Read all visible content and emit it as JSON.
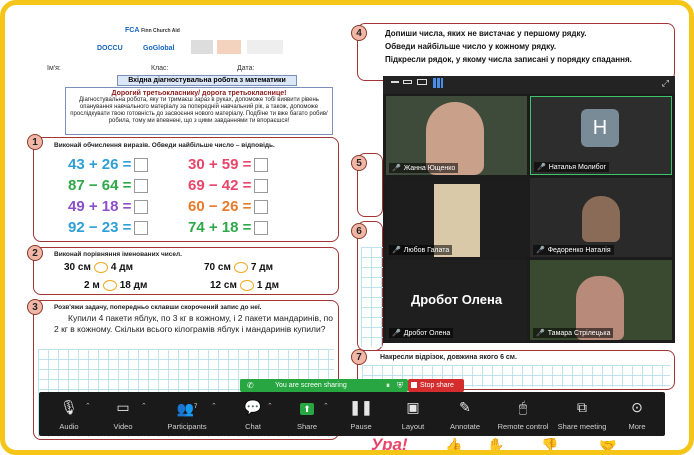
{
  "worksheet": {
    "logos": [
      "FCA",
      "Finn Church Aid",
      "DOCCU",
      "GoGlobal"
    ],
    "name_label": "Ім'я:",
    "class_label": "Клас:",
    "date_label": "Дата:",
    "title": "Вхідна діагностувальна робота з математики",
    "intro_heading": "Дорогий третьокласнику/ дорога третьокласнице!",
    "intro_text": "Діагностувальна робота, яку ти тримаєш зараз в руках, допоможе тобі виявити рівень опанування навчального матеріалу за попередній навчальний рік, а також, допоможе прослідкувати твою готовність до засвоєння нового матеріалу. Подбіне ти вже багато робив/робила, тому ми впевнені, що з цими завданнями ти впораєшся!",
    "task1": {
      "num": "1",
      "title": "Виконай обчислення виразів. Обведи найбільше число – відповідь.",
      "rows": [
        "43 + 26 =",
        "30 + 59 =",
        "87 − 64 =",
        "69 − 42 =",
        "49 + 18 =",
        "60 − 26 =",
        "92 − 23 =",
        "74 + 18 ="
      ]
    },
    "task2": {
      "num": "2",
      "title": "Виконай порівняння іменованих чисел.",
      "rows": [
        [
          "30 см",
          "4 дм"
        ],
        [
          "70 см",
          "7 дм"
        ],
        [
          "2 м",
          "18 дм"
        ],
        [
          "12 см",
          "1 дм"
        ]
      ]
    },
    "task3": {
      "num": "3",
      "title": "Розв'яжи задачу, попередньо склавши скорочений запис до неї.",
      "problem": "Купили 4 пакети яблук, по 3 кг в кожному, і 2 пакети мандаринів, по 2 кг в кожному. Скільки всього кілограмів яблук і мандаринів купили?"
    },
    "task4": {
      "num": "4",
      "lines": [
        "Допиши числа, яких не вистачає у першому рядку.",
        "Обведи найбільше число у кожному рядку.",
        "Підкресли рядок, у якому числа записані у порядку спадання."
      ]
    },
    "task5_num": "5",
    "task6_num": "6",
    "task7": {
      "num": "7",
      "title": "Накресли відрізок, довжина якого 6 см."
    },
    "bottom_text": "Ура!"
  },
  "meeting": {
    "participants": [
      {
        "name": "Жанна Ющенко"
      },
      {
        "name": "Наталья Молибог",
        "initial": "H"
      },
      {
        "name": "Любов Галата"
      },
      {
        "name": "Федоренко Наталія"
      },
      {
        "name": "Дробот Олена",
        "display": "Дробот Олена"
      },
      {
        "name": "Тамара Стрілецька"
      }
    ]
  },
  "share_banner": {
    "text": "You are screen sharing",
    "stop": "Stop share"
  },
  "toolbar": {
    "audio": "Audio",
    "video": "Video",
    "participants": "Participants",
    "participants_count": "7",
    "chat": "Chat",
    "share": "Share",
    "pause": "Pause",
    "layout": "Layout",
    "annotate": "Annotate",
    "remote": "Remote control",
    "share_meeting": "Share meeting",
    "more": "More"
  },
  "colors": {
    "accent": "#f5c518",
    "share_green": "#27a641",
    "stop_red": "#d42d2d"
  }
}
